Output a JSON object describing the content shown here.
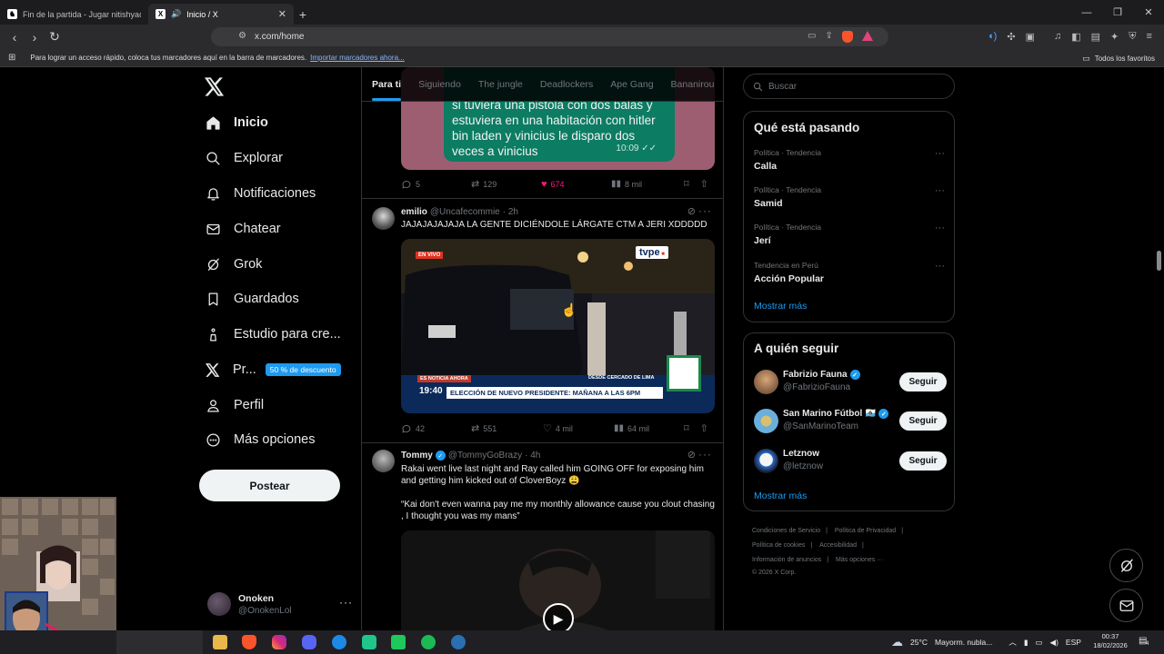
{
  "browser": {
    "tabs": [
      {
        "title": "Fin de la partida - Jugar nitishyadav1",
        "active": false
      },
      {
        "title": "Inicio / X",
        "active": true
      }
    ],
    "url": "x.com/home",
    "bookmarks_hint": "Para lograr un acceso rápido, coloca tus marcadores aquí en la barra de marcadores.",
    "bookmarks_link": "Importar marcadores ahora...",
    "bookmarks_all": "Todos los favoritos"
  },
  "nav": {
    "items": [
      {
        "label": "Inicio",
        "icon": "home-icon"
      },
      {
        "label": "Explorar",
        "icon": "search-icon"
      },
      {
        "label": "Notificaciones",
        "icon": "bell-icon"
      },
      {
        "label": "Chatear",
        "icon": "mail-icon"
      },
      {
        "label": "Grok",
        "icon": "grok-icon"
      },
      {
        "label": "Guardados",
        "icon": "bookmark-icon"
      },
      {
        "label": "Estudio para cre...",
        "icon": "studio-icon"
      },
      {
        "label": "Pr...",
        "icon": "x-premium-icon",
        "badge": "50 % de descuento"
      },
      {
        "label": "Perfil",
        "icon": "person-icon"
      },
      {
        "label": "Más opciones",
        "icon": "more-circle-icon"
      }
    ],
    "post_button": "Postear",
    "account": {
      "name": "Onoken",
      "handle": "@OnokenLol"
    }
  },
  "feed": {
    "tabs": [
      "Para ti",
      "Siguiendo",
      "The jungle",
      "Deadlockers",
      "Ape Gang",
      "Bananirou"
    ],
    "tweet0": {
      "bubble_text": "si tuviera una pistola con dos balas y estuviera en una habitación con hitler bin laden y vinicius le disparo dos veces a vinicius",
      "bubble_time": "10:09",
      "replies": "5",
      "reposts": "129",
      "likes": "674",
      "views": "8 mil"
    },
    "tweet1": {
      "name": "emilio",
      "handle": "@Uncafecommie",
      "time": "· 2h",
      "text": "JAJAJAJAJAJA LA GENTE DICIÉNDOLE LÁRGATE CTM A JERI XDDDDD",
      "media": {
        "live": "EN VIVO",
        "channel": "tvpe",
        "breaking": "ES NOTICIA AHORA",
        "location": "DESDE CERCADO DE LIMA",
        "clock": "19:40",
        "headline": "ELECCIÓN DE NUEVO PRESIDENTE: MAÑANA A LAS 6PM"
      },
      "replies": "42",
      "reposts": "551",
      "likes": "4 mil",
      "views": "64 mil"
    },
    "tweet2": {
      "name": "Tommy",
      "handle": "@TommyGoBrazy",
      "time": "· 4h",
      "text1": "Rakai went live last night and Ray called him GOING OFF for exposing him and getting him kicked out of CloverBoyz 😩",
      "text2": "“Kai don't even wanna pay me my monthly allowance cause you clout chasing , I thought you was my mans”"
    }
  },
  "sidebar": {
    "search_placeholder": "Buscar",
    "trends_title": "Qué está pasando",
    "trends": [
      {
        "context": "Política · Tendencia",
        "name": "Calla"
      },
      {
        "context": "Política · Tendencia",
        "name": "Samid"
      },
      {
        "context": "Política · Tendencia",
        "name": "Jerí"
      },
      {
        "context": "Tendencia en Perú",
        "name": "Acción Popular"
      }
    ],
    "show_more": "Mostrar más",
    "follow_title": "A quién seguir",
    "follow": [
      {
        "name": "Fabrizio Fauna",
        "handle": "@FabrizioFauna",
        "button": "Seguir"
      },
      {
        "name": "San Marino Fútbol 🇸🇲",
        "handle": "@SanMarinoTeam",
        "button": "Seguir"
      },
      {
        "name": "Letznow",
        "handle": "@letznow",
        "button": "Seguir"
      }
    ],
    "footer": [
      "Condiciones de Servicio",
      "Política de Privacidad",
      "Política de cookies",
      "Accesibilidad",
      "Información de anuncios",
      "Más opciones ···",
      "© 2026 X Corp."
    ]
  },
  "taskbar": {
    "weather": "25°C",
    "weather_text": "Mayorm. nubla...",
    "lang": "ESP",
    "time": "00:37",
    "date": "18/02/2026",
    "notif_count": "4"
  },
  "colors": {
    "accent": "#1d9bf0",
    "like": "#f91880",
    "bg": "#000000"
  }
}
